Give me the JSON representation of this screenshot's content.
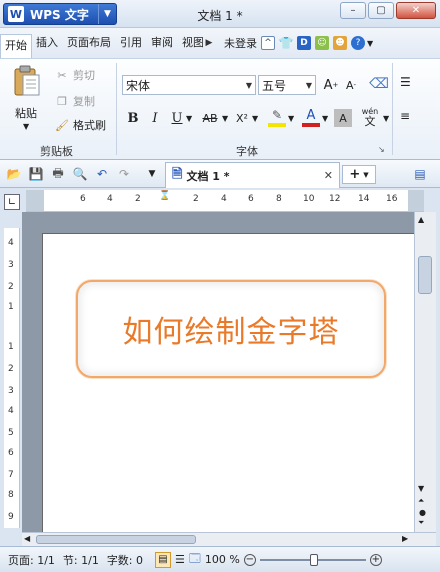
{
  "app": {
    "menu_button": "WPS 文字",
    "window_title": "文档 1 *"
  },
  "window_controls": [
    "–",
    "▢",
    "✕"
  ],
  "menu_tabs": [
    "开始",
    "插入",
    "页面布局",
    "引用",
    "审阅",
    "视图"
  ],
  "account": {
    "login": "未登录"
  },
  "ribbon": {
    "clipboard": {
      "paste": "粘贴",
      "cut": "剪切",
      "copy": "复制",
      "format_painter": "格式刷",
      "label": "剪贴板"
    },
    "font": {
      "font_name": "宋体",
      "font_size": "五号",
      "grow": "A",
      "shrink": "A",
      "bold": "B",
      "italic": "I",
      "underline": "U",
      "strikethrough": "AB",
      "superscript": "X²",
      "font_color_letter": "A",
      "char_shading_letter": "A",
      "phonetic": "wén",
      "phonetic_char": "文",
      "label": "字体"
    }
  },
  "document_tab": {
    "name": "文档 1 *",
    "new_tab": "+"
  },
  "ruler": {
    "horizontal_ticks": [
      "6",
      "4",
      "2",
      "2",
      "4",
      "6",
      "8",
      "10",
      "12",
      "14",
      "16"
    ],
    "vertical_ticks": [
      "4",
      "3",
      "2",
      "1",
      "1",
      "2",
      "3",
      "4",
      "5",
      "6",
      "7",
      "8",
      "9"
    ]
  },
  "document": {
    "shape_text": "如何绘制金字塔"
  },
  "statusbar": {
    "page": "页面: 1/1",
    "section": "节: 1/1",
    "word_count": "字数: 0",
    "zoom": "100 %"
  },
  "colors": {
    "accent": "#1d4fb0",
    "shape_text": "#e87a2a",
    "shape_border": "#f2a86a"
  }
}
